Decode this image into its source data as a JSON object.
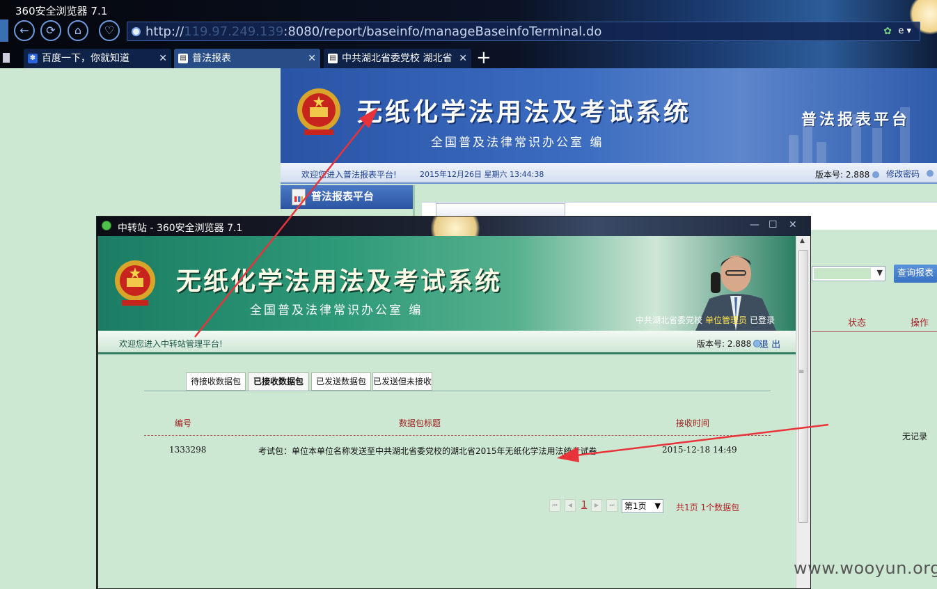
{
  "browser": {
    "title": "360安全浏览器 7.1",
    "url_prefix": "http://",
    "url_masked": "119.97.249.139",
    "url_rest": ":8080/report/baseinfo/manageBaseinfoTerminal.do",
    "tabs": [
      {
        "label": "百度一下，你就知道"
      },
      {
        "label": "普法报表"
      },
      {
        "label": "中共湖北省委党校 湖北省"
      }
    ]
  },
  "bg_page": {
    "banner_title": "无纸化学法用法及考试系统",
    "banner_sub": "全国普及法律常识办公室 编",
    "platform_title": "普法报表平台",
    "welcome": "欢迎您进入普法报表平台!",
    "datetime": "2015年12月26日 星期六 13:44:38",
    "version": "版本号: 2.888",
    "change_password": "修改密码",
    "side_menu_title": "普法报表平台",
    "query_button": "查询报表",
    "col_status": "状态",
    "col_action": "操作",
    "no_record": "无记录"
  },
  "window": {
    "title": "中转站 - 360安全浏览器 7.1",
    "min": "—",
    "max": "☐",
    "close": "✕",
    "banner_title": "无纸化学法用法及考试系统",
    "banner_sub": "全国普及法律常识办公室 编",
    "org": "中共湖北省委党校",
    "role": "单位管理员",
    "logged_in": "已登录",
    "welcome": "欢迎您进入中转站管理平台!",
    "version": "版本号: 2.888",
    "logout": "退 出",
    "tabs": [
      {
        "label": "待接收数据包"
      },
      {
        "label": "已接收数据包"
      },
      {
        "label": "已发送数据包"
      },
      {
        "label": "已发送但未接收"
      }
    ],
    "table": {
      "headers": [
        "编号",
        "数据包标题",
        "接收时间"
      ],
      "rows": [
        {
          "id": "1333298",
          "title": "考试包：单位本单位名称发送至中共湖北省委党校的湖北省2015年无纸化学法用法统考试卷",
          "time": "2015-12-18 14:49"
        }
      ]
    },
    "pager": {
      "current": "1",
      "select": "第1页",
      "summary": "共1页 1个数据包"
    }
  },
  "watermark": "www.wooyun.org",
  "colors": {
    "annotation_arrow": "#e8333a",
    "header_red": "#9e1b1b"
  }
}
